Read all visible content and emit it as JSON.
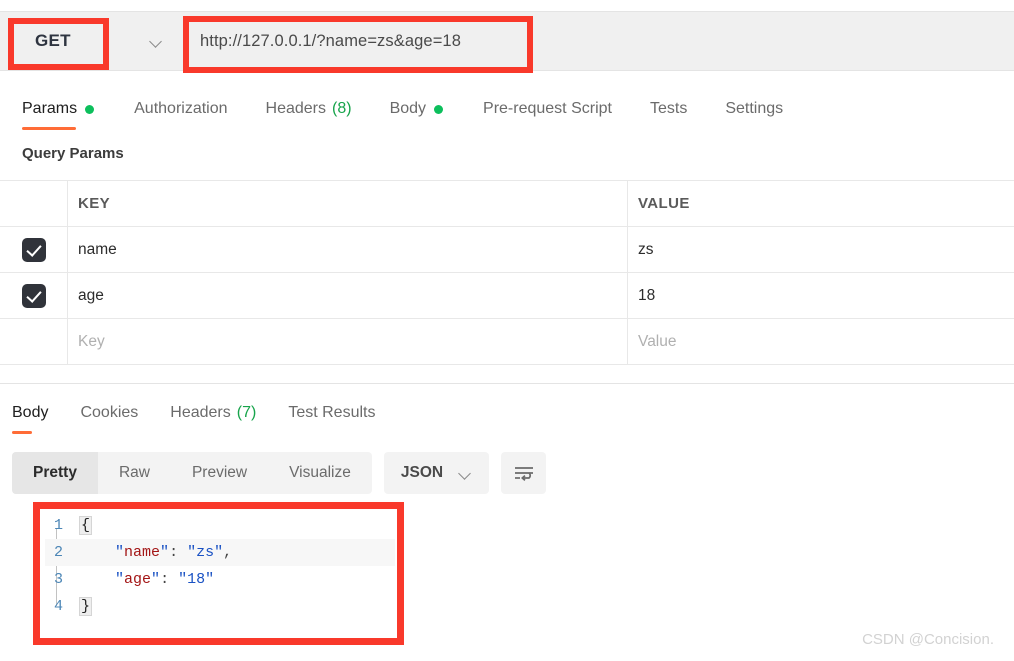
{
  "request": {
    "method": "GET",
    "url": "http://127.0.0.1/?name=zs&age=18",
    "tabs": [
      {
        "label": "Params",
        "badge": "dot",
        "active": true
      },
      {
        "label": "Authorization",
        "badge": "",
        "active": false
      },
      {
        "label": "Headers",
        "badge": "(8)",
        "active": false
      },
      {
        "label": "Body",
        "badge": "dot",
        "active": false
      },
      {
        "label": "Pre-request Script",
        "badge": "",
        "active": false
      },
      {
        "label": "Tests",
        "badge": "",
        "active": false
      },
      {
        "label": "Settings",
        "badge": "",
        "active": false
      }
    ],
    "params_section_title": "Query Params",
    "table": {
      "headers": {
        "key": "KEY",
        "value": "VALUE"
      },
      "rows": [
        {
          "checked": true,
          "key": "name",
          "value": "zs"
        },
        {
          "checked": true,
          "key": "age",
          "value": "18"
        }
      ],
      "placeholder_row": {
        "key": "Key",
        "value": "Value"
      }
    }
  },
  "response": {
    "tabs": [
      {
        "label": "Body",
        "badge": "",
        "active": true
      },
      {
        "label": "Cookies",
        "badge": "",
        "active": false
      },
      {
        "label": "Headers",
        "badge": "(7)",
        "active": false
      },
      {
        "label": "Test Results",
        "badge": "",
        "active": false
      }
    ],
    "view_modes": [
      {
        "label": "Pretty",
        "active": true
      },
      {
        "label": "Raw",
        "active": false
      },
      {
        "label": "Preview",
        "active": false
      },
      {
        "label": "Visualize",
        "active": false
      }
    ],
    "format": "JSON",
    "body_lines": [
      {
        "no": "1",
        "open_brace": "{"
      },
      {
        "no": "2",
        "key": "name",
        "value": "zs",
        "comma": ","
      },
      {
        "no": "3",
        "key": "age",
        "value": "18",
        "comma": ""
      },
      {
        "no": "4",
        "close_brace": "}"
      }
    ]
  },
  "watermark": "CSDN @Concision.",
  "colors": {
    "accent": "#ff6c37",
    "annotation": "#f9392b",
    "status_dot": "#0cbf5c",
    "count_green": "#17a44b"
  }
}
